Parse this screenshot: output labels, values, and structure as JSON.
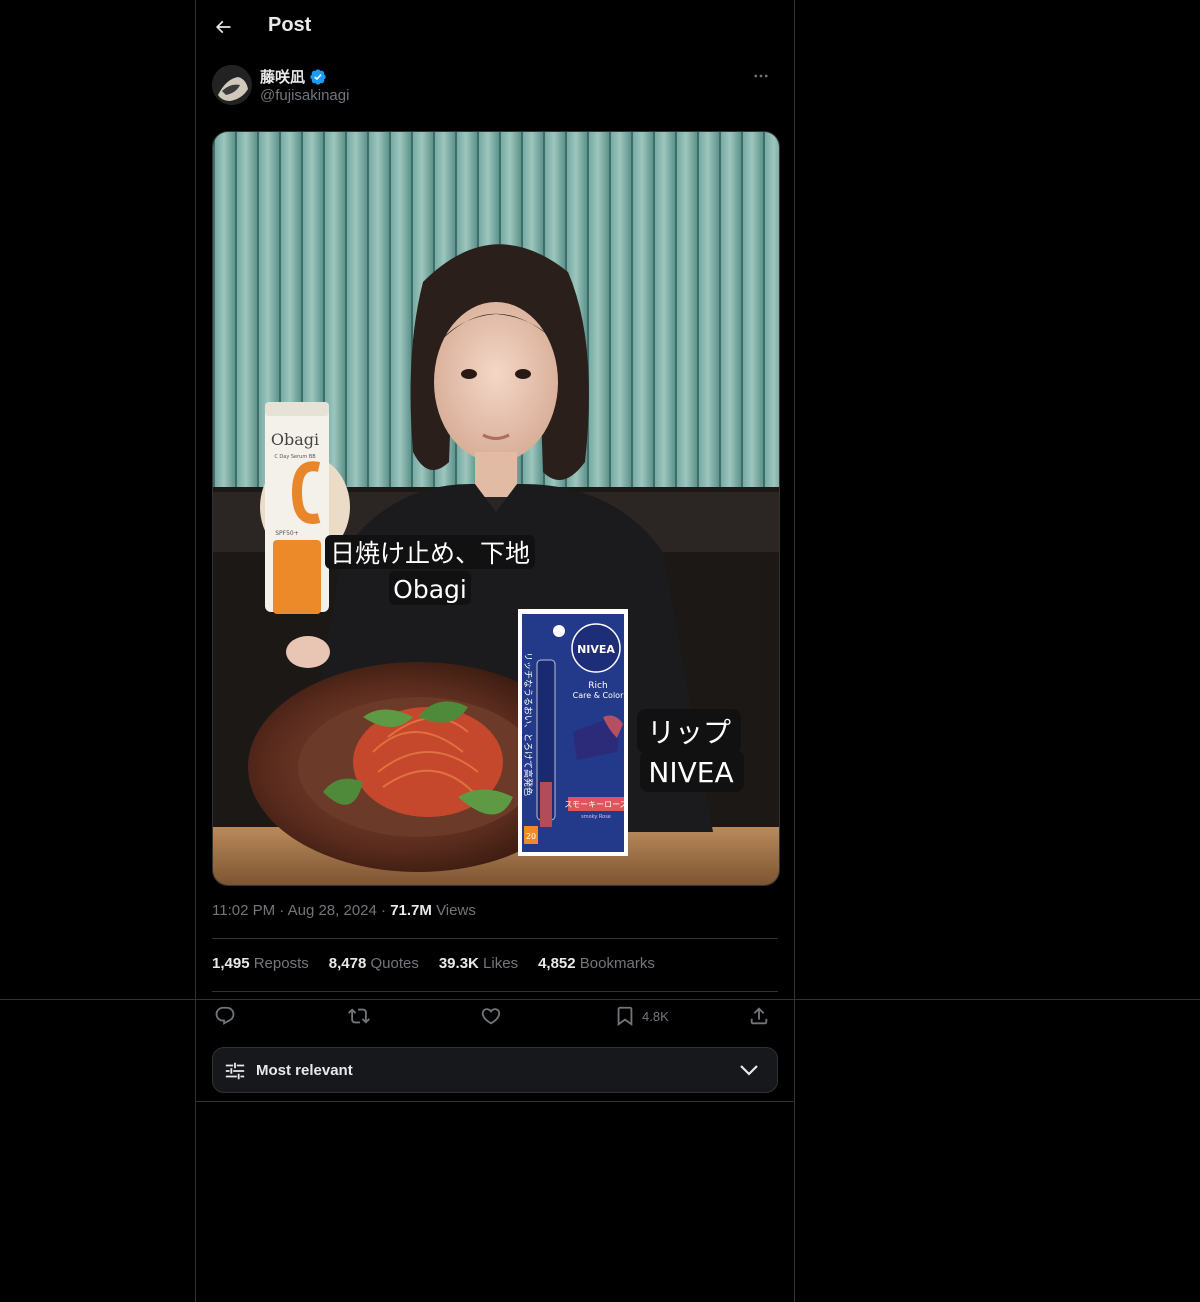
{
  "header": {
    "title": "Post"
  },
  "author": {
    "display_name": "藤咲凪",
    "handle": "@fujisakinagi"
  },
  "media": {
    "overlay_left_line1": "日焼け止め、下地",
    "overlay_left_line2": "Obagi",
    "overlay_right_line1": "リップ",
    "overlay_right_line2": "NIVEA",
    "obagi_brand": "Obagi",
    "obagi_sub": "C Day Serum BB",
    "obagi_spf": "SPF50+",
    "nivea_brand": "NIVEA",
    "nivea_line1": "Rich",
    "nivea_line2": "Care & Color",
    "nivea_vertical": "リッチなうるおい、とろけて高発色",
    "nivea_shade": "スモーキーローズ",
    "nivea_shade_en": "smoky Rose",
    "nivea_spf": "20"
  },
  "meta": {
    "time": "11:02 PM",
    "sep1": "·",
    "date": "Aug 28, 2024",
    "sep2": "·",
    "views_count": "71.7M",
    "views_label": "Views"
  },
  "stats": {
    "reposts_count": "1,495",
    "reposts_label": "Reposts",
    "quotes_count": "8,478",
    "quotes_label": "Quotes",
    "likes_count": "39.3K",
    "likes_label": "Likes",
    "bookmarks_count": "4,852",
    "bookmarks_label": "Bookmarks"
  },
  "actions": {
    "bookmark_count": "4.8K"
  },
  "sort": {
    "label": "Most relevant"
  },
  "icons": [
    "back-arrow-icon",
    "verified-badge-icon",
    "more-icon",
    "reply-icon",
    "repost-icon",
    "like-icon",
    "bookmark-icon",
    "share-icon",
    "sliders-icon",
    "chevron-down-icon"
  ],
  "colors": {
    "accent": "#1d9bf0",
    "muted": "#71767b",
    "text": "#e7e9ea",
    "border": "#2f3336"
  }
}
